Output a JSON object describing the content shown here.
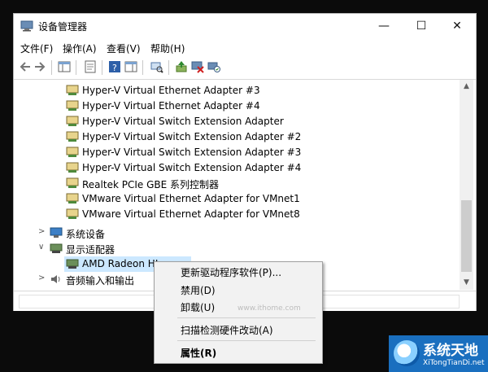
{
  "window": {
    "title": "设备管理器",
    "minimize_glyph": "—",
    "maximize_glyph": "☐",
    "close_glyph": "✕"
  },
  "menu": [
    "文件(F)",
    "操作(A)",
    "查看(V)",
    "帮助(H)"
  ],
  "toolbar_icons": [
    "back-arrow-icon",
    "forward-arrow-icon",
    "show-hide-console-tree-icon",
    "properties-icon",
    "help-icon",
    "action-pane-icon",
    "scan-hardware-icon",
    "update-driver-icon",
    "uninstall-device-icon",
    "scan-for-changes-icon"
  ],
  "tree": {
    "network_adapters": [
      "Hyper-V Virtual Ethernet Adapter #3",
      "Hyper-V Virtual Ethernet Adapter #4",
      "Hyper-V Virtual Switch Extension Adapter",
      "Hyper-V Virtual Switch Extension Adapter #2",
      "Hyper-V Virtual Switch Extension Adapter #3",
      "Hyper-V Virtual Switch Extension Adapter #4",
      "Realtek PCIe GBE 系列控制器",
      "VMware Virtual Ethernet Adapter for VMnet1",
      "VMware Virtual Ethernet Adapter for VMnet8"
    ],
    "system_devices": "系统设备",
    "display_adapters": "显示适配器",
    "display_child": "AMD Radeon HI",
    "audio": "音频输入和输出"
  },
  "context_menu": {
    "update_driver": "更新驱动程序软件(P)...",
    "disable": "禁用(D)",
    "uninstall": "卸载(U)",
    "scan": "扫描检测硬件改动(A)",
    "properties": "属性(R)"
  },
  "watermark": "www.ithome.com",
  "logo": {
    "cn": "系统天地",
    "en": "XiTongTianDi.net"
  },
  "colors": {
    "accent": "#1a6fbf",
    "background": "#0b0b0b"
  }
}
